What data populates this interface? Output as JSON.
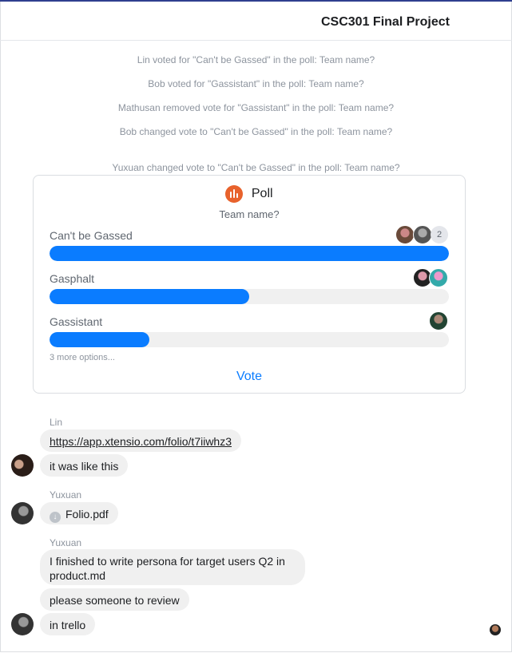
{
  "header": {
    "title": "CSC301 Final Project"
  },
  "system_messages": [
    "Lin voted for \"Can't be Gassed\" in the poll: Team name?",
    "Bob voted for \"Gassistant\" in the poll: Team name?",
    "Mathusan removed vote for \"Gassistant\" in the poll: Team name?",
    "Bob changed vote to \"Can't be Gassed\" in the poll: Team name?",
    "Yuxuan changed vote to \"Can't be Gassed\" in the poll: Team name?"
  ],
  "poll": {
    "label": "Poll",
    "question": "Team name?",
    "options": [
      {
        "label": "Can't be Gassed",
        "fill_fraction": 1.0,
        "voter_count": "2"
      },
      {
        "label": "Gasphalt",
        "fill_fraction": 0.5
      },
      {
        "label": "Gassistant",
        "fill_fraction": 0.25
      }
    ],
    "more_options": "3 more options...",
    "vote_label": "Vote"
  },
  "messages": {
    "lin_sender": "Lin",
    "lin_link": "https://app.xtensio.com/folio/t7iiwhz3",
    "lin_text": "it was like this",
    "yuxuan_sender_1": "Yuxuan",
    "file_name": "Folio.pdf",
    "yuxuan_sender_2": "Yuxuan",
    "yuxuan_text_1": "I finished to write persona for target users Q2 in product.md",
    "yuxuan_text_2": "please someone to review",
    "yuxuan_text_3": "in trello"
  },
  "colors": {
    "accent": "#0a7cff",
    "poll_icon": "#e8622c",
    "bubble": "#f0f0f0"
  },
  "icons": {
    "poll": "bar-chart-icon",
    "file": "download-icon"
  }
}
